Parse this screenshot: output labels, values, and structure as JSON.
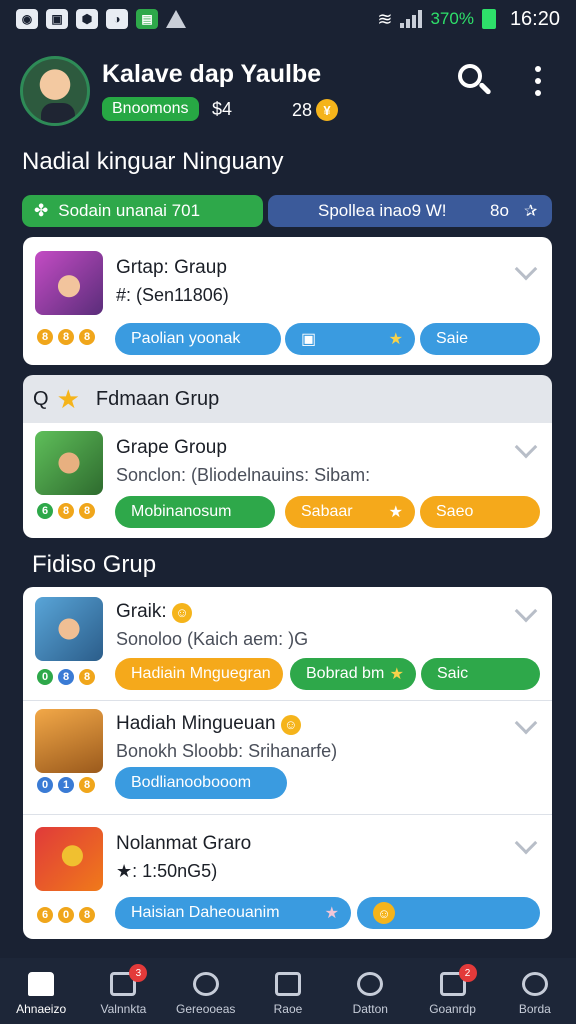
{
  "status_bar": {
    "battery_pct": "370%",
    "time": "16:20",
    "left_icons": [
      "app-icon-1",
      "app-icon-2",
      "app-icon-3",
      "app-icon-4",
      "app-icon-5",
      "warning-icon"
    ]
  },
  "header": {
    "title": "Kalave dap Yaulbe",
    "badge": "Bnoomons",
    "amount": "$4",
    "coins": "28"
  },
  "section1_title": "Nadial kinguar Ninguany",
  "filters": {
    "green_label": "Sodain unanai 701",
    "blue_label": "Spollea inao9 W!",
    "blue_count": "8o"
  },
  "group1": {
    "title": "Grtap: Graup",
    "subtitle": "#: (Sen11806)",
    "mini": [
      "8",
      "8",
      "8"
    ],
    "pill1": "Paolian yoonak",
    "pill3": "Saie"
  },
  "band": {
    "prefix": "Q",
    "label": "Fdmaan Grup"
  },
  "group2": {
    "title": "Grape Group",
    "subtitle": "Sonclon: (Bliodelnauins: Sibam:",
    "mini": [
      "6",
      "8",
      "8"
    ],
    "pill1": "Mobinanosum",
    "pill2": "Sabaar",
    "pill3": "Saeo"
  },
  "section2_title": "Fidiso Grup",
  "list": [
    {
      "title": "Graik:",
      "subtitle": "Sonoloo (Kaich aem: )G",
      "mini": [
        "0",
        "8",
        "8"
      ],
      "pill1": "Hadiain Mnguegran",
      "pill2": "Bobrad bm",
      "pill3": "Saic"
    },
    {
      "title": "Hadiah Mingueuan",
      "subtitle": "Bonokh Sloobb: Srihanarfe)",
      "mini": [
        "0",
        "1",
        "8"
      ],
      "pill1": "Bodlianoobooom"
    },
    {
      "title": "Nolanmat Graro",
      "subtitle": "★: 1:50nG5)",
      "mini": [
        "6",
        "0",
        "8"
      ],
      "pill1": "Haisian Daheouanim"
    }
  ],
  "bottom_nav": [
    {
      "label": "Ahnaeizo",
      "badge": ""
    },
    {
      "label": "Valnnkta",
      "badge": "3"
    },
    {
      "label": "Gereooeas",
      "badge": ""
    },
    {
      "label": "Raoe",
      "badge": ""
    },
    {
      "label": "Datton",
      "badge": ""
    },
    {
      "label": "Goanrdp",
      "badge": "2"
    },
    {
      "label": "Borda",
      "badge": ""
    }
  ]
}
